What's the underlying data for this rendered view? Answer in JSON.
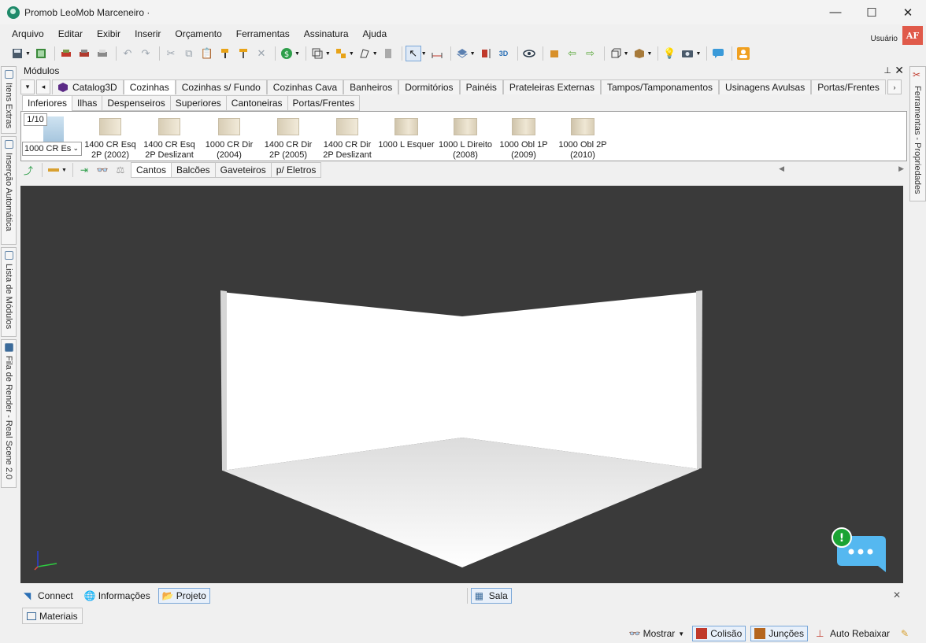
{
  "window": {
    "title": "Promob LeoMob Marceneiro ·",
    "controls": [
      "—",
      "☐",
      "✕"
    ]
  },
  "menu": [
    "Arquivo",
    "Editar",
    "Exibir",
    "Inserir",
    "Orçamento",
    "Ferramentas",
    "Assinatura",
    "Ajuda"
  ],
  "user": {
    "label": "Usuário",
    "badge": "AF"
  },
  "modules_panel": {
    "title": "Módulos",
    "pin": "📌",
    "close": "✕",
    "nav_down": "▾",
    "nav_prev": "◂",
    "nav_next": "›",
    "category_tabs": [
      "Catalog3D",
      "Cozinhas",
      "Cozinhas s/ Fundo",
      "Cozinhas Cava",
      "Banheiros",
      "Dormitórios",
      "Painéis",
      "Prateleiras Externas",
      "Tampos/Tamponamentos",
      "Usinagens Avulsas",
      "Portas/Frentes"
    ],
    "active_category": "Cozinhas",
    "sub_tabs": [
      "Inferiores",
      "Ilhas",
      "Despenseiros",
      "Superiores",
      "Cantoneiras",
      "Portas/Frentes"
    ],
    "active_sub": "Inferiores",
    "page_indicator": "1/10",
    "combo_value": "1000 CR Es",
    "items": [
      "1400 CR Esq 2P (2002)",
      "1400 CR Esq 2P Deslizant",
      "1000 CR Dir (2004)",
      "1400 CR Dir 2P (2005)",
      "1400 CR Dir 2P Deslizant",
      "1000 L Esquer",
      "1000 L Direito (2008)",
      "1000 Obl 1P (2009)",
      "1000 Obl 2P (2010)"
    ]
  },
  "sub_toolbar": {
    "tabs": [
      "Cantos",
      "Balcões",
      "Gaveteiros",
      "p/ Eletros"
    ],
    "active": "Cantos"
  },
  "left_side_tabs": [
    "Itens Extras",
    "Inserção Automática",
    "Lista de Módulos",
    "Fila de Render - Real Scene 2.0"
  ],
  "right_side_tab": "Ferramentas - Propriedades",
  "project_bar": {
    "items": [
      "Connect",
      "Informações",
      "Projeto"
    ],
    "active": "Projeto",
    "room": "Sala",
    "close": "✕"
  },
  "materials_tab": "Materiais",
  "status_bar": {
    "items": [
      "Mostrar",
      "Colisão",
      "Junções",
      "Auto Rebaixar"
    ]
  },
  "colors": {
    "viewport_bg": "#3a3a3a",
    "chat_bubble": "#55b8f0",
    "notification": "#1aa333",
    "badge": "#e05a4a"
  }
}
